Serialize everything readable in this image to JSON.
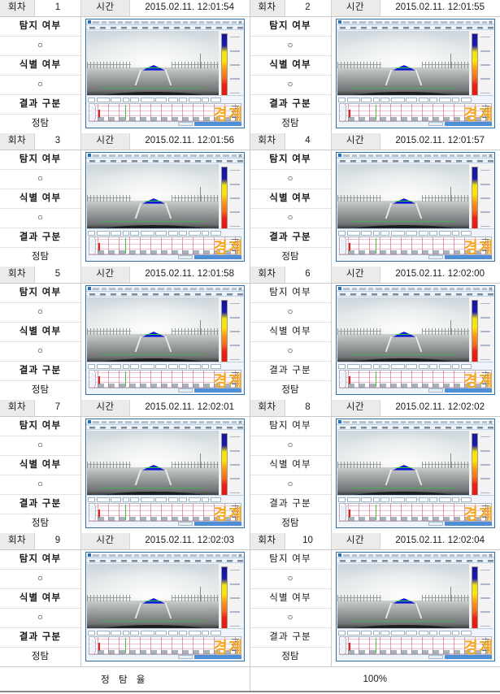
{
  "table": {
    "columns": {
      "round_label": "회차",
      "time_label": "시간"
    },
    "row_labels": {
      "detection": "탐지 여부",
      "detection_value": "○",
      "identification": "식별 여부",
      "identification_value": "○",
      "result": "결과 구분",
      "result_value": "정탐"
    },
    "alert_text": "경계",
    "entries": [
      {
        "round": "1",
        "time": "2015.02.11.  12:01:54",
        "bold": true
      },
      {
        "round": "2",
        "time": "2015.02.11.  12:01:55",
        "bold": true
      },
      {
        "round": "3",
        "time": "2015.02.11.  12:01:56",
        "bold": true
      },
      {
        "round": "4",
        "time": "2015.02.11.  12:01:57",
        "bold": true
      },
      {
        "round": "5",
        "time": "2015.02.11.  12:01:58",
        "bold": true
      },
      {
        "round": "6",
        "time": "2015.02.11.  12:02:00",
        "bold": false
      },
      {
        "round": "7",
        "time": "2015.02.11.  12:02:01",
        "bold": true
      },
      {
        "round": "8",
        "time": "2015.02.11.  12:02:02",
        "bold": false
      },
      {
        "round": "9",
        "time": "2015.02.11.  12:02:03",
        "bold": true
      },
      {
        "round": "10",
        "time": "2015.02.11.  12:02:04",
        "bold": false
      }
    ]
  },
  "footer": {
    "label": "정 탐 율",
    "value": "100%"
  },
  "colors": {
    "alert": "#f5a61e",
    "roi": "#28d92a",
    "blob": "#1016d8",
    "header_bg": "#ebebeb",
    "border": "#c9c9c9",
    "scale_top": "#141496",
    "scale_mid": "#ffe400",
    "scale_bottom": "#e8140c"
  }
}
